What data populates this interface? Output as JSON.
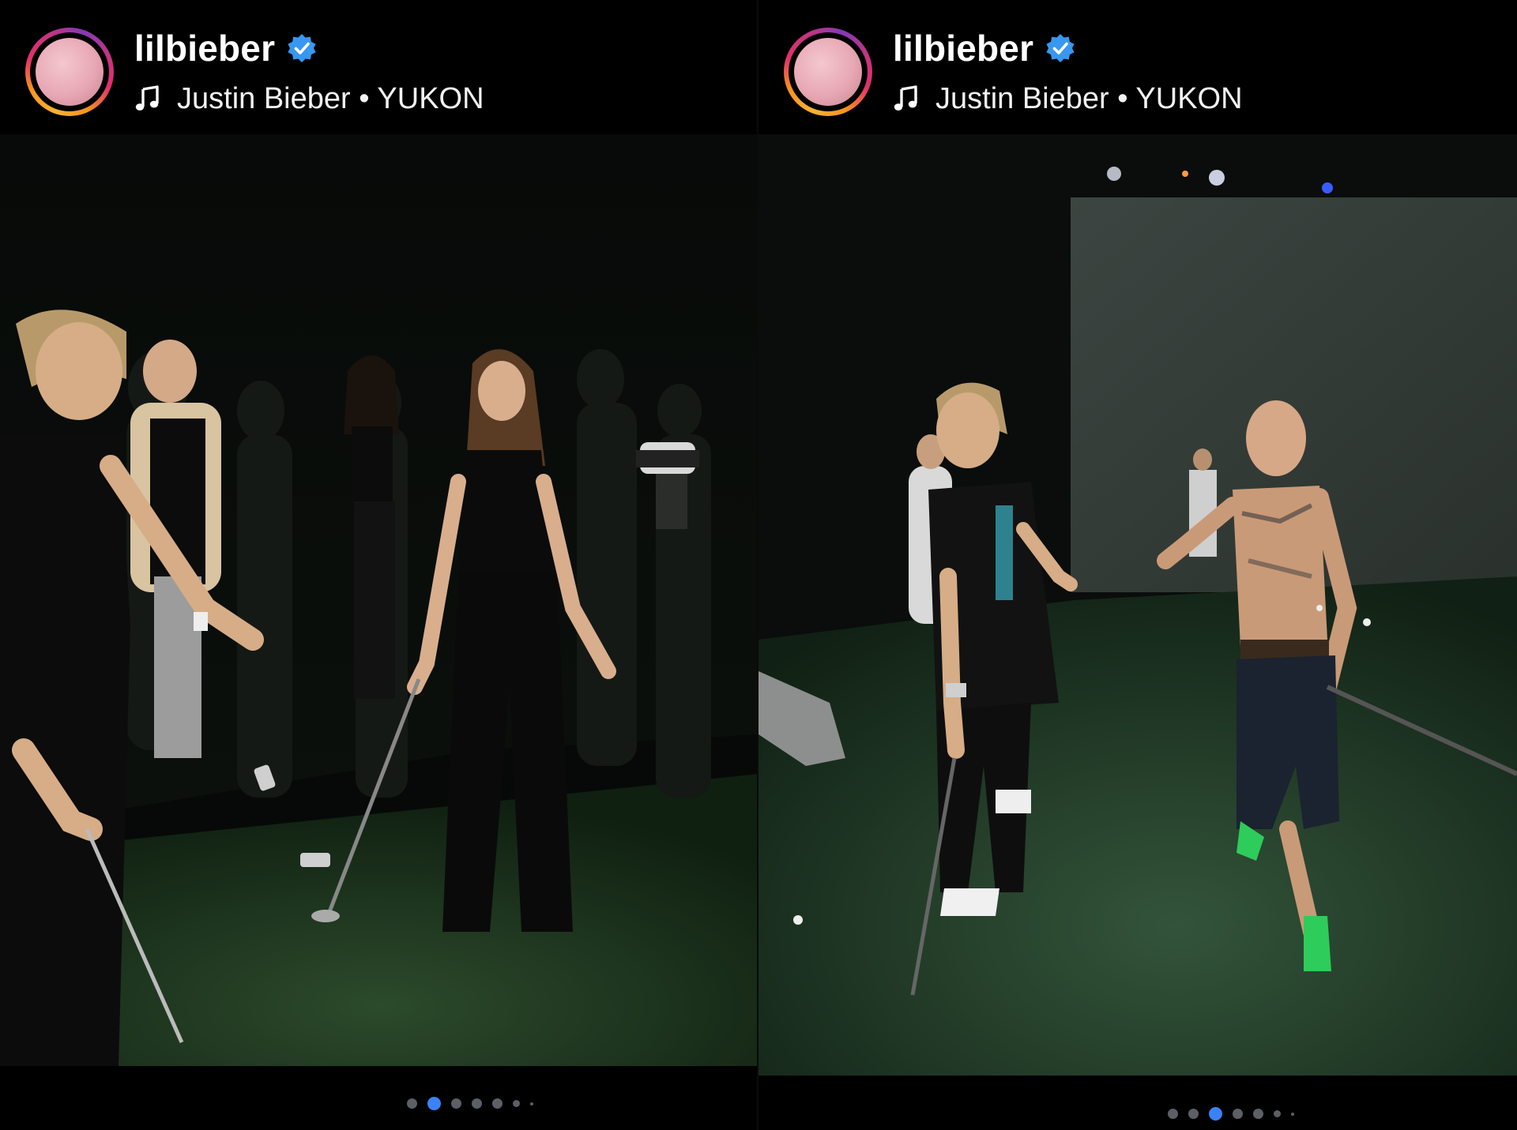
{
  "posts": [
    {
      "username": "lilbieber",
      "verified": true,
      "audio": {
        "artist": "Justin Bieber",
        "separator": "•",
        "track": "YUKON"
      },
      "photo": {
        "description_icon": "photo",
        "scene": "party-golf-simulator-left"
      },
      "carousel": {
        "total_dots": 7,
        "active_index": 1
      }
    },
    {
      "username": "lilbieber",
      "verified": true,
      "audio": {
        "artist": "Justin Bieber",
        "separator": "•",
        "track": "YUKON"
      },
      "photo": {
        "description_icon": "photo",
        "scene": "party-golf-simulator-right"
      },
      "carousel": {
        "total_dots": 7,
        "active_index": 2
      }
    }
  ],
  "colors": {
    "background": "#000000",
    "verified_badge": "#3897f0",
    "active_dot": "#3b82f6",
    "inactive_dot": "#5c5f66",
    "turf": "#1f3a1f"
  }
}
